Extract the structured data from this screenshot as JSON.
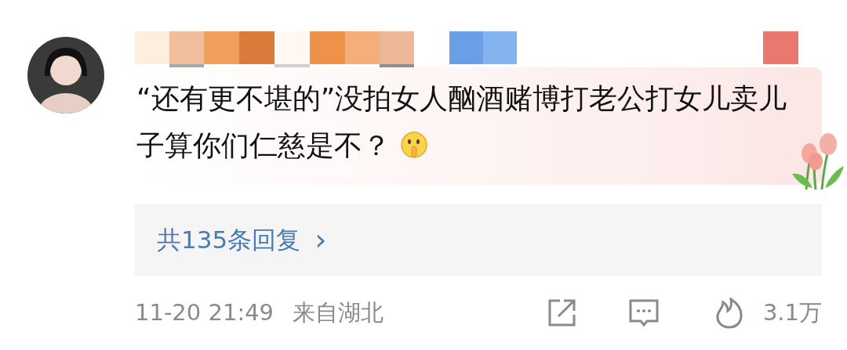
{
  "comment": {
    "text": "“还有更不堪的”没拍女人酗酒赌博打老公打女儿卖儿子算你们仁慈是不？"
  },
  "replies": {
    "label": "共135条回复",
    "arrow": "›"
  },
  "footer": {
    "time": "11-20 21:49",
    "location": "来自湖北",
    "likes": "3.1万"
  }
}
